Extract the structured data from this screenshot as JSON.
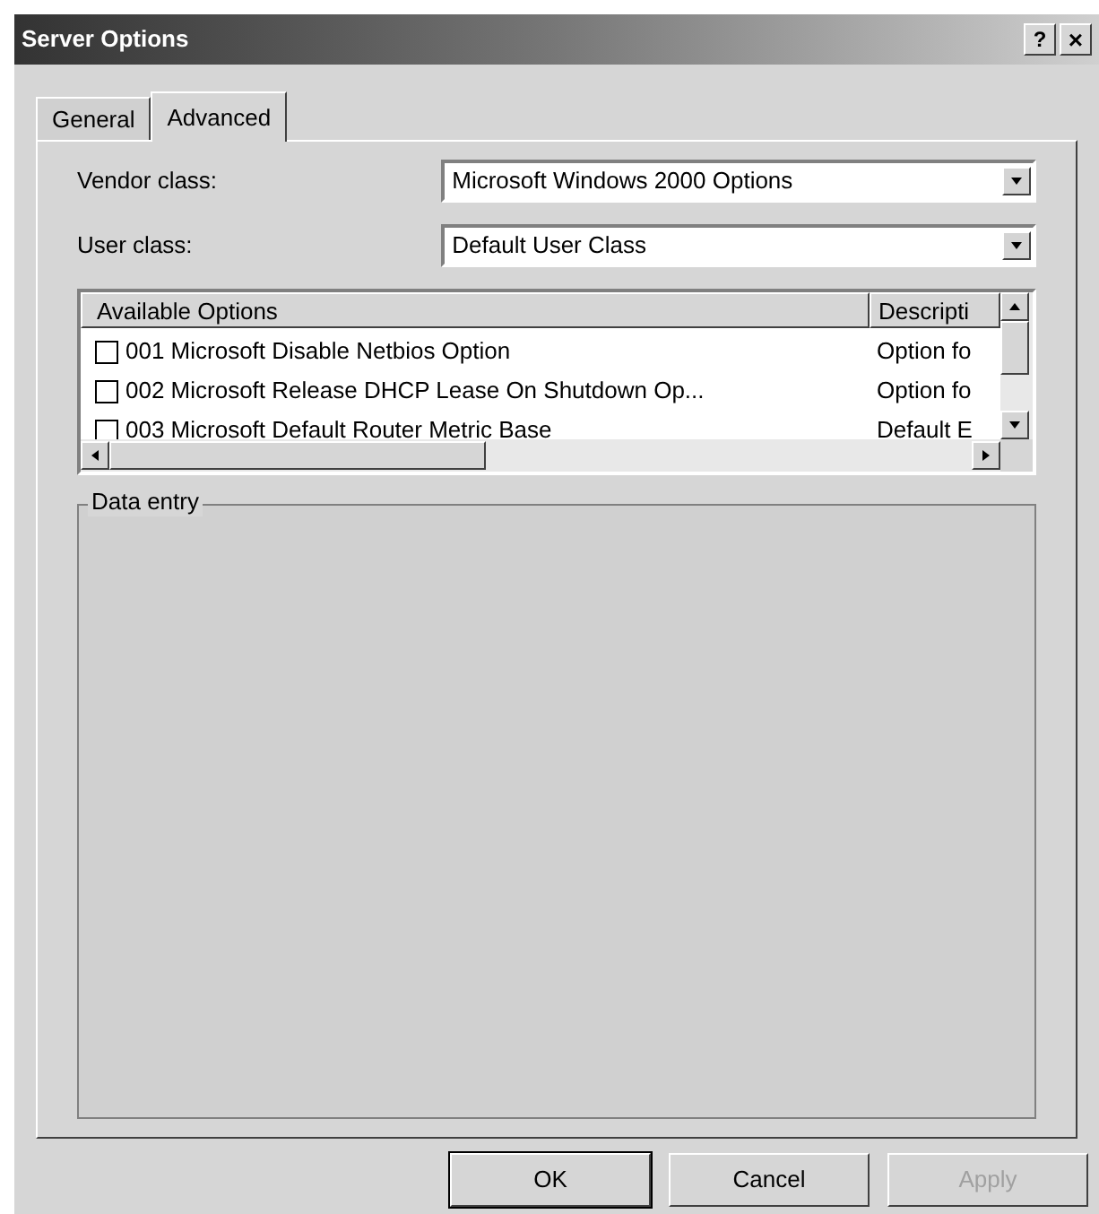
{
  "window": {
    "title": "Server Options",
    "help_button": "?",
    "close_button": "×"
  },
  "tabs": [
    {
      "label": "General",
      "selected": false
    },
    {
      "label": "Advanced",
      "selected": true
    }
  ],
  "vendor_class": {
    "label": "Vendor class:",
    "value": "Microsoft Windows 2000 Options"
  },
  "user_class": {
    "label": "User class:",
    "value": "Default User Class"
  },
  "options_list": {
    "columns": [
      "Available Options",
      "Descripti"
    ],
    "rows": [
      {
        "name": "001 Microsoft Disable Netbios Option",
        "description": "Option fo",
        "checked": false
      },
      {
        "name": "002 Microsoft Release DHCP Lease On Shutdown Op...",
        "description": "Option fo",
        "checked": false
      },
      {
        "name": "003 Microsoft Default Router Metric Base",
        "description": "Default E",
        "checked": false
      }
    ]
  },
  "data_entry": {
    "label": "Data entry"
  },
  "buttons": [
    {
      "label": "OK",
      "disabled": false,
      "default": true
    },
    {
      "label": "Cancel",
      "disabled": false,
      "default": false
    },
    {
      "label": "Apply",
      "disabled": true,
      "default": false
    }
  ]
}
